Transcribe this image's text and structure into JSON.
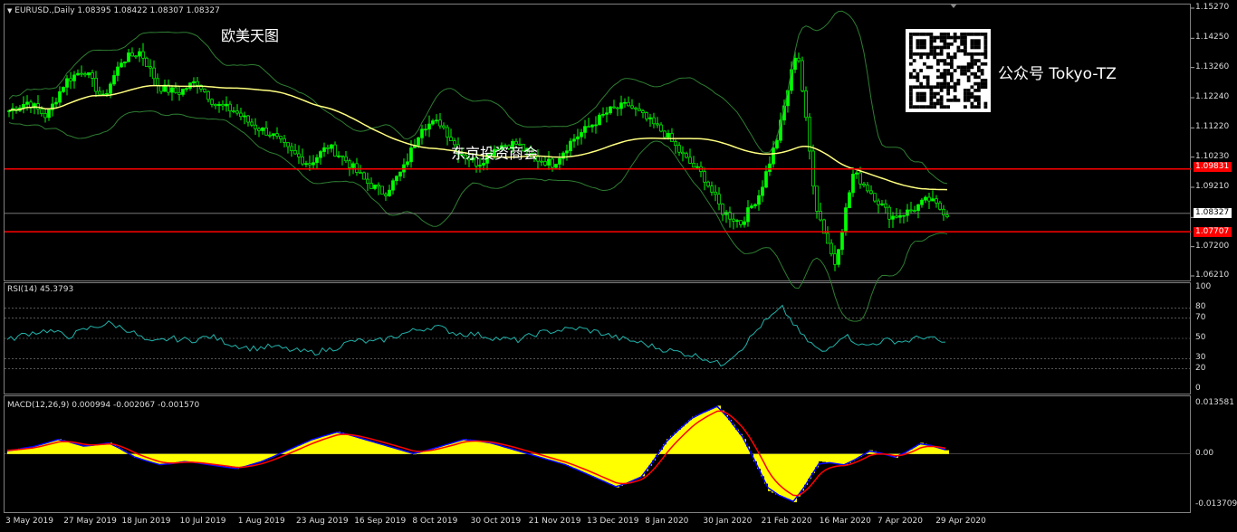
{
  "header": {
    "symbol_line": "EURUSD.,Daily  1.08395 1.08422 1.08307 1.08327"
  },
  "watermarks": {
    "top_left": "欧美天图",
    "center": "东京投资商会",
    "account": "公众号 Tokyo-TZ"
  },
  "price_scale": [
    "1.15270",
    "1.14250",
    "1.13260",
    "1.12240",
    "1.11220",
    "1.10230",
    "1.09210",
    "1.08190",
    "1.07200",
    "1.06210"
  ],
  "price_labels": {
    "upper_line": "1.09831",
    "current": "1.08327",
    "lower_line": "1.07707"
  },
  "rsi": {
    "label": "RSI(14) 45.3793",
    "scale": [
      "100",
      "80",
      "70",
      "50",
      "30",
      "20",
      "0"
    ]
  },
  "macd": {
    "label": "MACD(12,26,9) 0.000994 -0.002067 -0.001570",
    "scale": [
      "0.013581",
      "0.00",
      "-0.013709"
    ]
  },
  "dates": [
    "3 May 2019",
    "27 May 2019",
    "18 Jun 2019",
    "10 Jul 2019",
    "1 Aug 2019",
    "23 Aug 2019",
    "16 Sep 2019",
    "8 Oct 2019",
    "30 Oct 2019",
    "21 Nov 2019",
    "13 Dec 2019",
    "8 Jan 2020",
    "30 Jan 2020",
    "21 Feb 2020",
    "16 Mar 2020",
    "7 Apr 2020",
    "29 Apr 2020"
  ],
  "colors": {
    "bull": "#00ff00",
    "bear": "#00ff00",
    "ma": "#ffff80",
    "bands": "#2e7d32",
    "hline": "#ff0000",
    "rsi": "#20b2aa",
    "hist": "#ffff00",
    "macd": "#0000ff",
    "signal": "#ff0000"
  },
  "chart_data": {
    "type": "line",
    "title": "EURUSD., Daily",
    "ylim": [
      1.0621,
      1.1527
    ],
    "horizontal_lines": [
      1.09831,
      1.07707
    ],
    "close_series_weekly": [
      1.118,
      1.121,
      1.116,
      1.128,
      1.132,
      1.122,
      1.135,
      1.138,
      1.126,
      1.124,
      1.128,
      1.12,
      1.118,
      1.113,
      1.11,
      1.104,
      1.1,
      1.106,
      1.101,
      1.094,
      1.09,
      1.098,
      1.113,
      1.114,
      1.104,
      1.1,
      1.106,
      1.107,
      1.102,
      1.1,
      1.108,
      1.113,
      1.118,
      1.12,
      1.115,
      1.11,
      1.102,
      1.096,
      1.084,
      1.08,
      1.09,
      1.11,
      1.14,
      1.086,
      1.066,
      1.097,
      1.09,
      1.082,
      1.084,
      1.088,
      1.083
    ],
    "rsi_series": [
      48,
      55,
      58,
      52,
      60,
      65,
      58,
      45,
      50,
      48,
      52,
      44,
      40,
      42,
      38,
      36,
      40,
      48,
      46,
      52,
      58,
      62,
      55,
      54,
      50,
      48,
      55,
      58,
      60,
      56,
      50,
      46,
      40,
      36,
      32,
      24,
      40,
      64,
      80,
      52,
      35,
      54,
      42,
      48,
      47,
      52,
      45
    ],
    "macd_hist": [
      0.001,
      0.002,
      0.004,
      0.002,
      0.003,
      -0.001,
      -0.003,
      -0.002,
      -0.003,
      -0.004,
      -0.002,
      0.001,
      0.004,
      0.006,
      0.004,
      0.002,
      0.0,
      0.002,
      0.004,
      0.003,
      0.001,
      -0.001,
      -0.003,
      -0.006,
      -0.009,
      -0.006,
      0.004,
      0.01,
      0.013,
      0.004,
      -0.01,
      -0.013,
      -0.002,
      -0.003,
      0.001,
      -0.001,
      0.003,
      0.001
    ]
  }
}
